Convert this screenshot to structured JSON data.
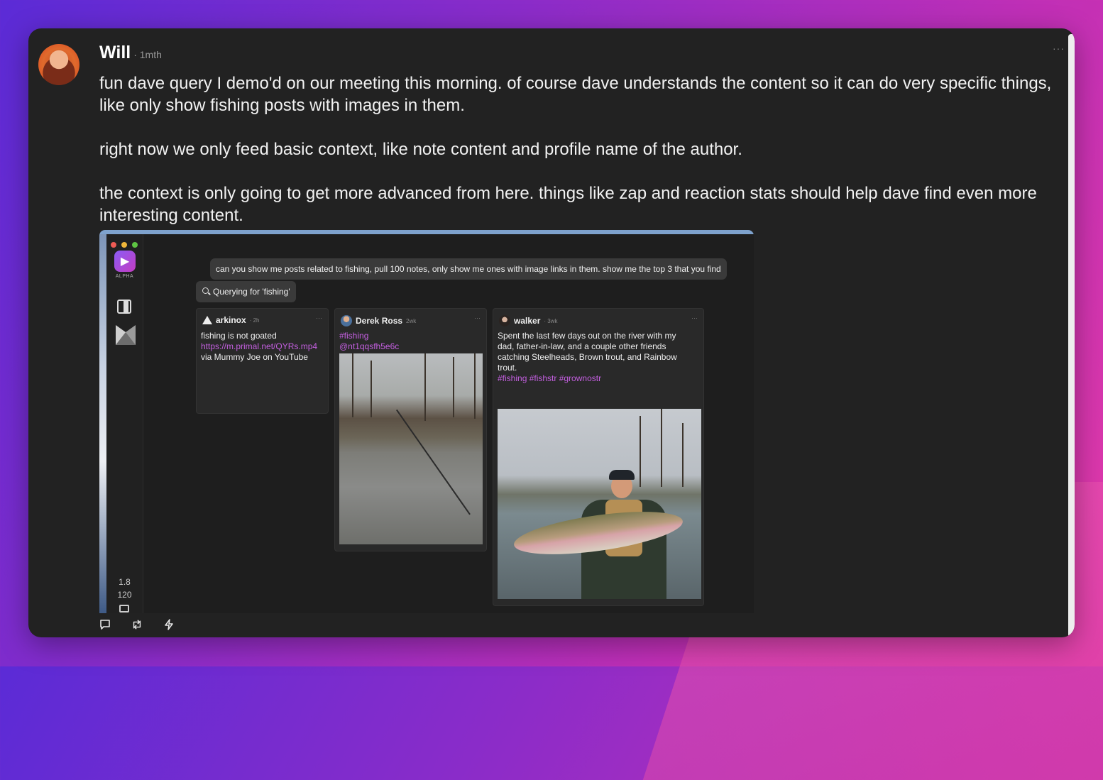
{
  "note": {
    "author_name": "Will",
    "timestamp": "· 1mth",
    "more_icon": "more-horizontal-icon",
    "content": "fun dave query I demo'd on our meeting this morning. of course dave understands the content so it can do very specific things, like only show fishing posts with images in them.\n\nright now we only feed basic context, like note content and profile name of the author.\n\nthe context is only going to get more advanced from here. things like zap and reaction stats should help dave find even more interesting content."
  },
  "screenshot": {
    "sidebar": {
      "app_label": "ALPHA",
      "stat_1": "1.8",
      "stat_2": "120"
    },
    "query": "can you show me posts related to fishing, pull 100 notes, only show me ones with image links in them. show me the top 3 that you find",
    "tool_call": "Querying for 'fishing'",
    "posts": [
      {
        "name": "arkinox",
        "time": "· 2h",
        "line_1": "fishing is not goated",
        "link": "https://m.primal.net/QYRs.mp4",
        "line_2": "via Mummy Joe on YouTube"
      },
      {
        "name": "Derek Ross",
        "time": "2wk",
        "hashtag": "#fishing",
        "mention": "@nt1qqsfh5e6c"
      },
      {
        "name": "walker",
        "time": "· 3wk",
        "body": "Spent the last few days out on the river with my dad, father-in-law, and a couple other friends catching Steelheads, Brown trout, and Rainbow trout.",
        "hashtags": "#fishing #fishstr #grownostr"
      }
    ]
  },
  "actions": [
    "reply-icon",
    "repost-icon",
    "zap-icon"
  ],
  "colors": {
    "card_bg": "#222222",
    "accent_pink": "#c45fe0",
    "bg_gradient_start": "#5b2bd6",
    "bg_gradient_end": "#e43aa8"
  }
}
